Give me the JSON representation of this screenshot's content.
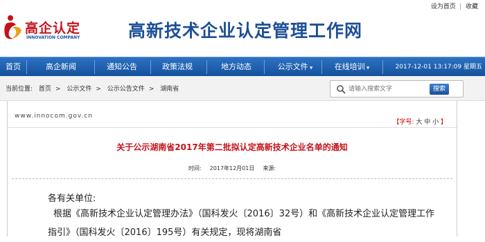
{
  "logo": {
    "cn": "高企认定",
    "en": "INNOVATION COMPANY"
  },
  "site_title": "高新技术企业认定管理工作网",
  "top_links": [
    "设为首页",
    "收藏"
  ],
  "nav": {
    "items": [
      {
        "label": "首页"
      },
      {
        "label": "高企新闻"
      },
      {
        "label": "通知公告"
      },
      {
        "label": "政策法规"
      },
      {
        "label": "地方动态"
      },
      {
        "label": "公示文件"
      },
      {
        "label": "在线培训"
      }
    ],
    "datetime": "2017-12-01 13:17:09 星期五"
  },
  "breadcrumb": {
    "prefix": "当前位置:",
    "items": [
      "首页",
      "公示文件",
      "公示公告文件",
      "湖南省"
    ]
  },
  "search": {
    "placeholder": "请输入搜索文字",
    "button": "搜索"
  },
  "article": {
    "site_url": "www.innocom.gov.cn",
    "font_size_label": "【字号:",
    "font_sizes": [
      "大",
      "中",
      "小"
    ],
    "font_size_close": "】",
    "title": "关于公示湖南省2017年第二批拟认定高新技术企业名单的通知",
    "time_label": "时间:",
    "date": "2017年12月01日",
    "source_label": "来源:",
    "greeting": "各有关单位:",
    "paragraph": "根据《高新技术企业认定管理办法》（国科发火〔2016〕32号）和《高新技术企业认定管理工作指引》（国科发火〔2016〕195号）有关规定，现将湖南省"
  },
  "colors": {
    "brand_red": "#c4121b",
    "brand_blue": "#1d4f97",
    "nav_blue": "#1f5fae"
  }
}
